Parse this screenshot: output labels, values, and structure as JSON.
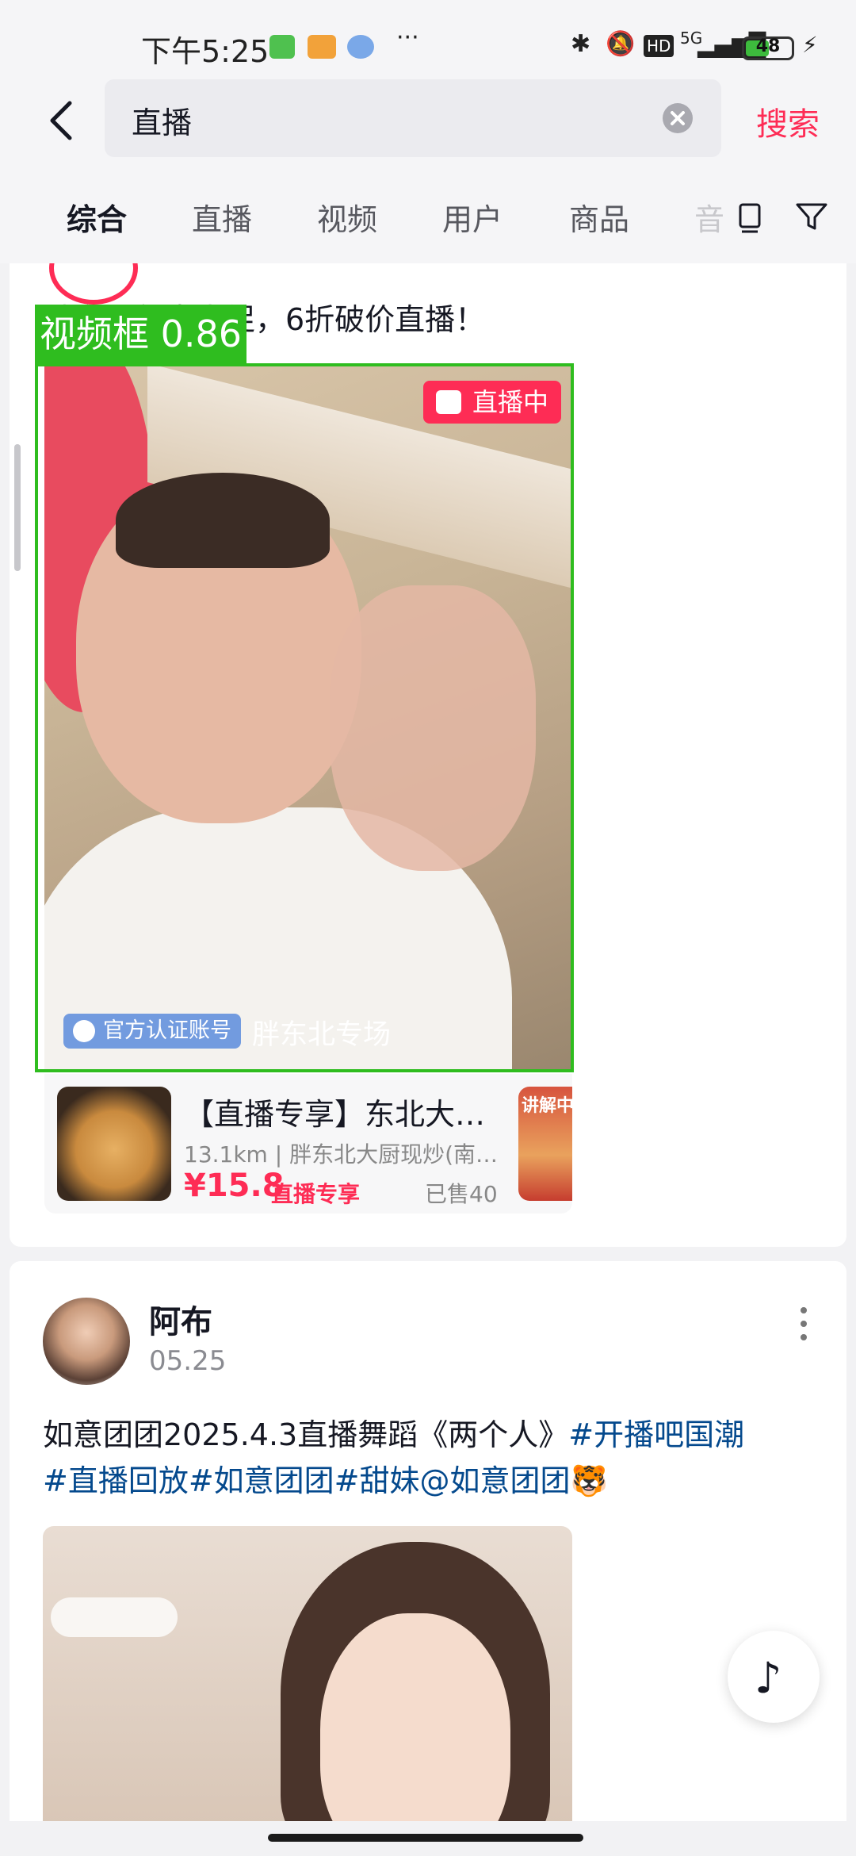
{
  "status_bar": {
    "time": "下午5:25",
    "network": "5G",
    "hd": "HD",
    "battery": "48"
  },
  "search": {
    "query": "直播",
    "search_button": "搜索"
  },
  "tabs": [
    "综合",
    "直播",
    "视频",
    "用户",
    "商品",
    "音"
  ],
  "card1": {
    "caption": "胖东北年中大促，6折破价直播！",
    "detection_label": "视频框 0.86",
    "live_badge": "直播中",
    "verify_badge": "官方认证账号",
    "shop_name": "胖东北专场",
    "product": {
      "title": "【直播专享】东北大…",
      "meta": "13.1km | 胖东北大厨现炒(南…",
      "price": "¥15.8",
      "price_tag": "直播专享",
      "sold": "已售40",
      "thumb_label": "讲解中"
    }
  },
  "card2": {
    "username": "阿布",
    "date": "05.25",
    "caption_text": "如意团团2025.4.3直播舞蹈《两个人》",
    "hashtags_line1": "#开播吧国潮",
    "hashtags_line2": "#直播回放#如意团团#甜妹@如意团团🐯"
  }
}
